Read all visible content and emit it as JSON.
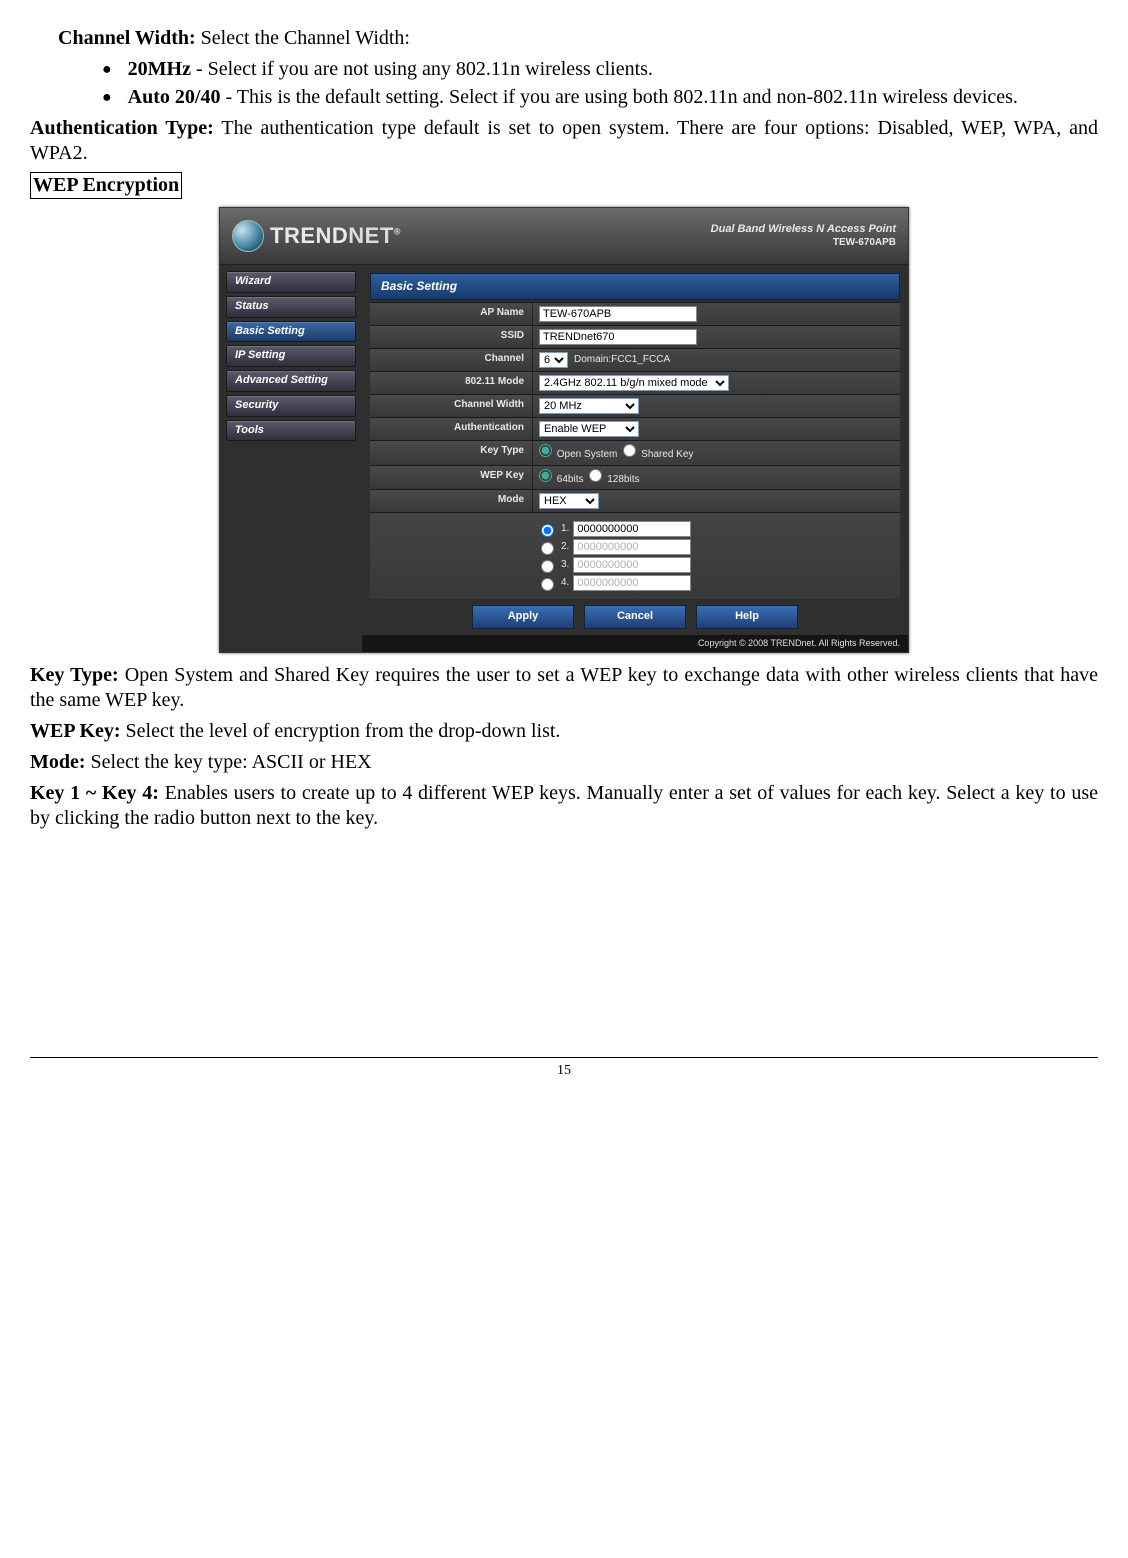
{
  "intro": {
    "channel_width_label": "Channel Width:",
    "channel_width_text": " Select the Channel Width:",
    "bullet1_label": "20MHz",
    "bullet1_text": " - Select if you are not using any 802.11n wireless clients.",
    "bullet2_label": "Auto 20/40",
    "bullet2_text": " - This is the default setting. Select if you are using both 802.11n and non-802.11n wireless devices.",
    "auth_label": "Authentication Type:",
    "auth_text": "  The authentication type default is set to open system. There are four options: Disabled, WEP, WPA, and WPA2.",
    "wep_heading": "WEP Encryption"
  },
  "router": {
    "logo_brand": "TREND",
    "logo_suffix": "NET",
    "logo_r": "®",
    "header_line1": "Dual Band Wireless N Access Point",
    "header_line2": "TEW-670APB",
    "nav": [
      "Wizard",
      "Status",
      "Basic Setting",
      "IP Setting",
      "Advanced Setting",
      "Security",
      "Tools"
    ],
    "panel_title": "Basic Setting",
    "labels": {
      "ap_name": "AP Name",
      "ssid": "SSID",
      "channel": "Channel",
      "mode80211": "802.11 Mode",
      "channel_width": "Channel Width",
      "authentication": "Authentication",
      "key_type": "Key Type",
      "wep_key": "WEP Key",
      "mode": "Mode"
    },
    "values": {
      "ap_name": "TEW-670APB",
      "ssid": "TRENDnet670",
      "channel": "6",
      "channel_domain": "Domain:FCC1_FCCA",
      "mode80211": "2.4GHz 802.11 b/g/n mixed mode",
      "channel_width": "20 MHz",
      "authentication": "Enable WEP",
      "key_type_open": "Open System",
      "key_type_shared": "Shared Key",
      "wep_64": "64bits",
      "wep_128": "128bits",
      "mode": "HEX",
      "k1": "1.",
      "k2": "2.",
      "k3": "3.",
      "k4": "4.",
      "kval": "0000000000"
    },
    "buttons": {
      "apply": "Apply",
      "cancel": "Cancel",
      "help": "Help"
    },
    "footer": "Copyright © 2008 TRENDnet. All Rights Reserved."
  },
  "below": {
    "key_type_label": "Key Type:",
    "key_type_text": " Open System and Shared Key requires the user to set a WEP key to exchange data with other wireless clients that have the same WEP key.",
    "wep_key_label": "WEP Key:",
    "wep_key_text": " Select the level of encryption from the drop-down list.",
    "mode_label": "Mode:",
    "mode_text": " Select the key type: ASCII or HEX",
    "key14_label": "Key 1 ~ Key 4:",
    "key14_text": " Enables users to create up to 4 different WEP keys. Manually enter a set of values for each key. Select a key to use by clicking the radio button next to the key."
  },
  "page_number": "15"
}
